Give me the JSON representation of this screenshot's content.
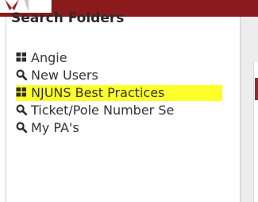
{
  "panel": {
    "title": "Search Folders"
  },
  "folders": [
    {
      "label": "Angie",
      "icon": "grid-icon"
    },
    {
      "label": "New Users",
      "icon": "search-icon"
    },
    {
      "label": "NJUNS Best Practices",
      "icon": "grid-icon",
      "highlighted": true
    },
    {
      "label": "Ticket/Pole Number Se",
      "icon": "search-icon"
    },
    {
      "label": "My PA's",
      "icon": "search-icon"
    }
  ],
  "colors": {
    "top_bar": "#8b1a1d",
    "highlight": "#ffff29",
    "text": "#333333",
    "icon": "#2b2b2b"
  }
}
